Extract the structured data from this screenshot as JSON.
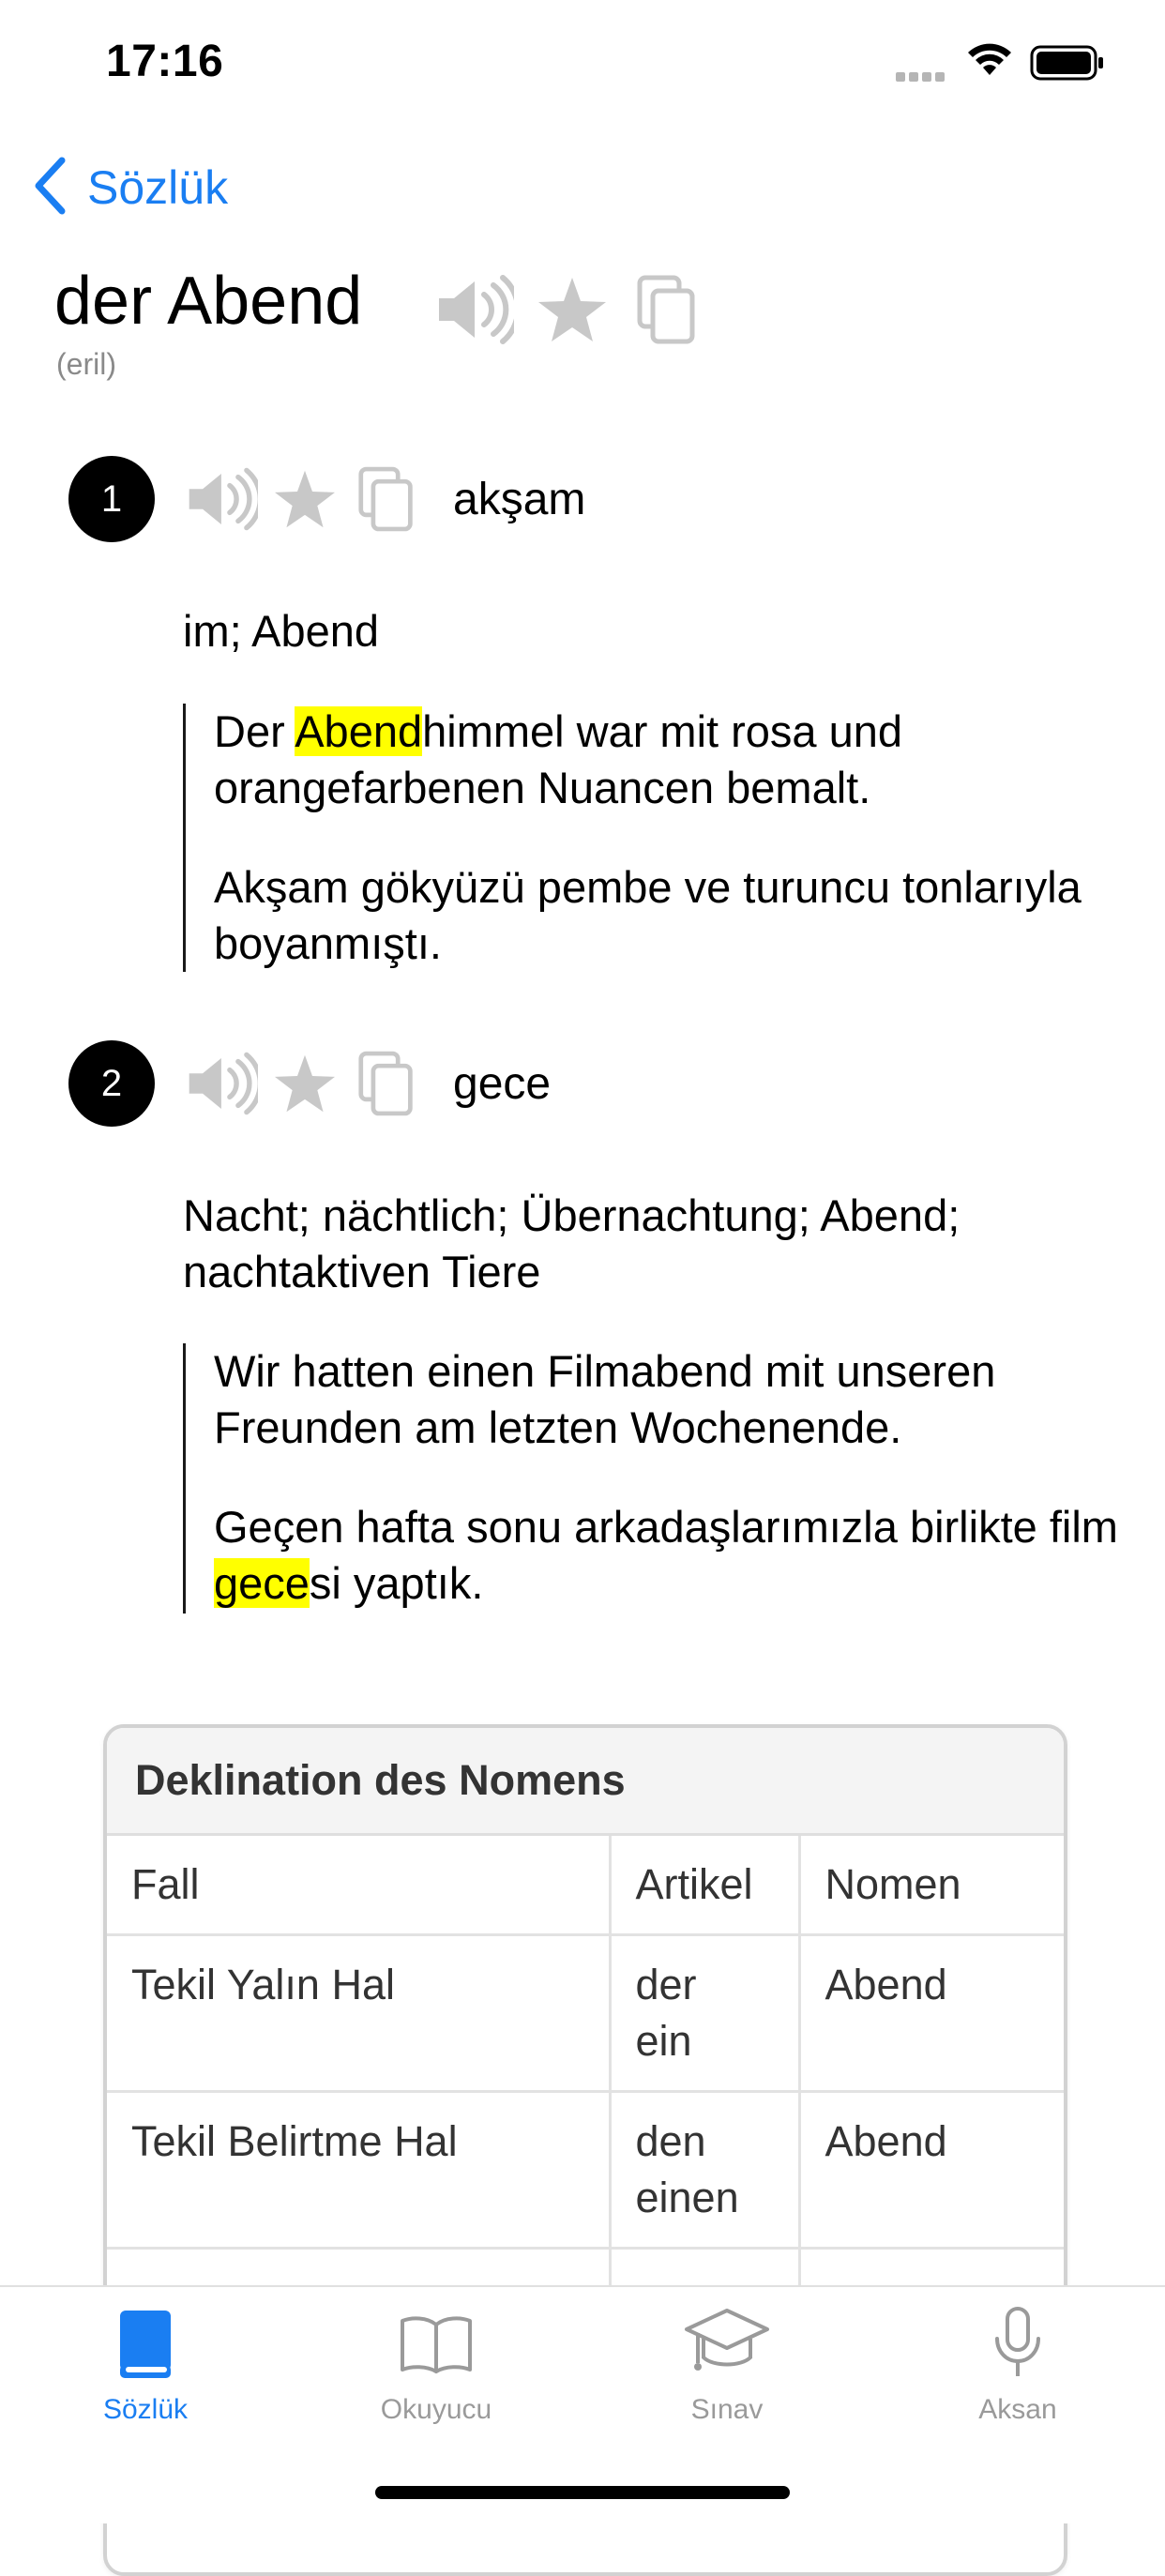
{
  "status_bar": {
    "time": "17:16"
  },
  "nav": {
    "back_label": "Sözlük"
  },
  "entry": {
    "headword": "der Abend",
    "gender": "(eril)",
    "senses": [
      {
        "number": "1",
        "translation": "akşam",
        "gloss": "im; Abend",
        "example_de_pre": "Der ",
        "example_de_mark": "Abend",
        "example_de_post": "himmel war mit rosa und orangefarbenen Nuancen bemalt.",
        "example_tr": "Akşam gökyüzü pembe ve turuncu tonlarıyla boyanmıştı."
      },
      {
        "number": "2",
        "translation": "gece",
        "gloss": "Nacht; nächtlich; Übernachtung; Abend; nachtaktiven Tiere",
        "example_de": "Wir hatten einen Filmabend mit unseren Freunden am letzten Wochenende.",
        "example_tr_pre": "Geçen hafta sonu arkadaşlarımızla birlikte film ",
        "example_tr_mark": "gece",
        "example_tr_post": "si yaptık."
      }
    ]
  },
  "declension": {
    "title": "Deklination des Nomens",
    "headers": [
      "Fall",
      "Artikel",
      "Nomen"
    ],
    "rows": [
      {
        "case": "Tekil Yalın Hal",
        "article_1": "der",
        "article_2": "ein",
        "noun": "Abend"
      },
      {
        "case": "Tekil Belirtme Hal",
        "article_1": "den",
        "article_2": "einen",
        "noun": "Abend"
      }
    ]
  },
  "tabbar": {
    "tabs": [
      {
        "label": "Sözlük",
        "icon": "book-filled-icon",
        "active": true
      },
      {
        "label": "Okuyucu",
        "icon": "open-book-icon",
        "active": false
      },
      {
        "label": "Sınav",
        "icon": "graduation-cap-icon",
        "active": false
      },
      {
        "label": "Aksan",
        "icon": "microphone-icon",
        "active": false
      }
    ]
  },
  "colors": {
    "accent": "#1a7ef2",
    "highlight": "#ffff00",
    "icon_gray": "#c8c8c8"
  }
}
